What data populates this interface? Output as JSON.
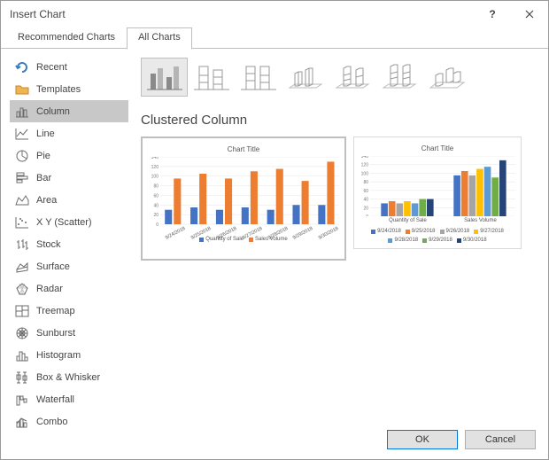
{
  "dialog": {
    "title": "Insert Chart"
  },
  "tabs": {
    "recommended": "Recommended Charts",
    "all": "All Charts"
  },
  "sidebar": {
    "items": [
      {
        "label": "Recent"
      },
      {
        "label": "Templates"
      },
      {
        "label": "Column"
      },
      {
        "label": "Line"
      },
      {
        "label": "Pie"
      },
      {
        "label": "Bar"
      },
      {
        "label": "Area"
      },
      {
        "label": "X Y (Scatter)"
      },
      {
        "label": "Stock"
      },
      {
        "label": "Surface"
      },
      {
        "label": "Radar"
      },
      {
        "label": "Treemap"
      },
      {
        "label": "Sunburst"
      },
      {
        "label": "Histogram"
      },
      {
        "label": "Box & Whisker"
      },
      {
        "label": "Waterfall"
      },
      {
        "label": "Combo"
      }
    ]
  },
  "main": {
    "heading": "Clustered Column",
    "preview1": {
      "title": "Chart Title",
      "legend1": "Quantity of Sale",
      "legend2": "Sales Volume",
      "dates": [
        "9/24/2018",
        "9/25/2018",
        "9/26/2018",
        "9/27/2018",
        "9/28/2018",
        "9/29/2018",
        "9/30/2018"
      ]
    },
    "preview2": {
      "title": "Chart Title",
      "xlabel1": "Quantity of Sale",
      "xlabel2": "Sales Volume",
      "dates": [
        "9/24/2018",
        "9/25/2018",
        "9/26/2018",
        "9/27/2018",
        "9/28/2018",
        "9/29/2018",
        "9/30/2018"
      ]
    }
  },
  "footer": {
    "ok": "OK",
    "cancel": "Cancel"
  },
  "colors": {
    "blue": "#4472c4",
    "orange": "#ed7d31",
    "gray": "#a5a5a5",
    "yellow": "#ffc000",
    "darkblue": "#5b9bd5",
    "green": "#70ad47",
    "navy": "#264478"
  },
  "chart_data": [
    {
      "type": "bar",
      "title": "Chart Title",
      "categories": [
        "9/24/2018",
        "9/25/2018",
        "9/26/2018",
        "9/27/2018",
        "9/28/2018",
        "9/29/2018",
        "9/30/2018"
      ],
      "series": [
        {
          "name": "Quantity of Sale",
          "values": [
            30,
            35,
            30,
            35,
            30,
            40,
            40
          ]
        },
        {
          "name": "Sales Volume",
          "values": [
            95,
            105,
            95,
            110,
            115,
            90,
            130
          ]
        }
      ],
      "ylim": [
        0,
        140
      ],
      "xlabel": "",
      "ylabel": ""
    },
    {
      "type": "bar",
      "title": "Chart Title",
      "groups": [
        "Quantity of Sale",
        "Sales Volume"
      ],
      "categories": [
        "9/24/2018",
        "9/25/2018",
        "9/26/2018",
        "9/27/2018",
        "9/28/2018",
        "9/29/2018",
        "9/30/2018"
      ],
      "series": [
        {
          "name": "Quantity of Sale",
          "values": [
            30,
            35,
            30,
            35,
            30,
            40,
            40
          ]
        },
        {
          "name": "Sales Volume",
          "values": [
            95,
            105,
            95,
            110,
            115,
            90,
            130
          ]
        }
      ],
      "ylim": [
        0,
        140
      ],
      "xlabel": "",
      "ylabel": ""
    }
  ]
}
